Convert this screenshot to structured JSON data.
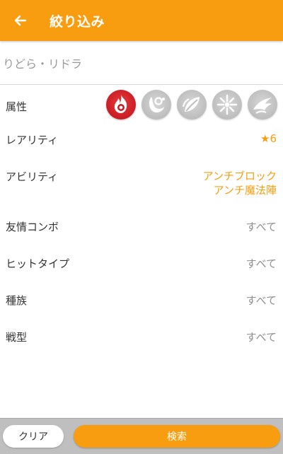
{
  "header": {
    "title": "絞り込み",
    "back_icon": "arrow-left-icon",
    "color": "#f79d0f"
  },
  "search": {
    "value": "りどら・リドラ",
    "placeholder": ""
  },
  "filters": {
    "attribute": {
      "label": "属性",
      "icons": [
        {
          "name": "fire-element-icon",
          "active": true
        },
        {
          "name": "water-element-icon",
          "active": false
        },
        {
          "name": "wood-element-icon",
          "active": false
        },
        {
          "name": "light-element-icon",
          "active": false
        },
        {
          "name": "dark-element-icon",
          "active": false
        }
      ]
    },
    "rarity": {
      "label": "レアリティ",
      "value": "★6"
    },
    "ability": {
      "label": "アビリティ",
      "value_line1": "アンチブロック",
      "value_line2": "アンチ魔法陣"
    },
    "friendship_combo": {
      "label": "友情コンボ",
      "value": "すべて"
    },
    "hit_type": {
      "label": "ヒットタイプ",
      "value": "すべて"
    },
    "race": {
      "label": "種族",
      "value": "すべて"
    },
    "battle_type": {
      "label": "戦型",
      "value": "すべて"
    }
  },
  "footer": {
    "clear_label": "クリア",
    "search_label": "検索"
  },
  "colors": {
    "accent": "#f79d0f",
    "fire": "#c91d24",
    "inactive": "#bdbdbd"
  }
}
